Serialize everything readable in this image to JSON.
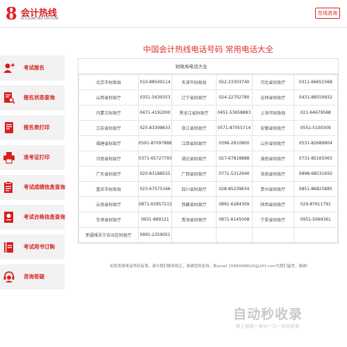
{
  "header": {
    "logo_title": "会计热线",
    "logo_subtitle": "ACCOUNTING HOTLINE",
    "online_button": "在线咨询"
  },
  "sidebar": {
    "items": [
      {
        "label": "考试报名",
        "icon": "user-register-icon"
      },
      {
        "label": "报名状态查询",
        "icon": "status-search-icon"
      },
      {
        "label": "报名表打印",
        "icon": "form-print-icon"
      },
      {
        "label": "准考证打印",
        "icon": "printer-icon"
      },
      {
        "label": "考试成绩信息查询",
        "icon": "score-search-icon"
      },
      {
        "label": "考试合格信息查询",
        "icon": "certificate-search-icon"
      },
      {
        "label": "考试用书订购",
        "icon": "book-icon"
      },
      {
        "label": "咨询答疑",
        "icon": "support-icon"
      }
    ]
  },
  "main": {
    "title": "中国会计热线电话号码 常用电话大全",
    "panel_heading": "财政局电话大全",
    "rows": [
      [
        {
          "name": "北京市财政局",
          "phone": "010-88549114"
        },
        {
          "name": "天津市财政局",
          "phone": "022-23303740"
        },
        {
          "name": "河北省财政厅",
          "phone": "0311-66651568"
        }
      ],
      [
        {
          "name": "山西省财政厅",
          "phone": "0351-5639353"
        },
        {
          "name": "辽宁省财政厅",
          "phone": "024-22702780"
        },
        {
          "name": "吉林省财政厅",
          "phone": "0431-88550932"
        }
      ],
      [
        {
          "name": "内蒙古财政厅",
          "phone": "0471-4192000"
        },
        {
          "name": "黑龙江省财政厅",
          "phone": "0451-53658883"
        },
        {
          "name": "上海市财政局",
          "phone": "021-64679568"
        }
      ],
      [
        {
          "name": "江苏省财政厅",
          "phone": "025-83398633"
        },
        {
          "name": "浙江省财政厅",
          "phone": "0571-87055714"
        },
        {
          "name": "安徽省财政厅",
          "phone": "0551-5100309"
        }
      ],
      [
        {
          "name": "福建省财政厅",
          "phone": "0591-87097888"
        },
        {
          "name": "江西省财政厅",
          "phone": "0396-2610800"
        },
        {
          "name": "山东省财政厅",
          "phone": "0531-82689904"
        }
      ],
      [
        {
          "name": "河南省财政厅",
          "phone": "0371-65727793"
        },
        {
          "name": "湖北省财政厅",
          "phone": "027-67818888"
        },
        {
          "name": "湖南省财政厅",
          "phone": "0731-85165063"
        }
      ],
      [
        {
          "name": "广东省财政厅",
          "phone": "020-83188555"
        },
        {
          "name": "广西省财政厅",
          "phone": "0771-5312940"
        },
        {
          "name": "海南省财政厅",
          "phone": "0898-68531650"
        }
      ],
      [
        {
          "name": "重庆市财政局",
          "phone": "023-67575166"
        },
        {
          "name": "四川省财政厅",
          "phone": "028-85239634"
        },
        {
          "name": "贵州省财政厅",
          "phone": "0851-86825885"
        }
      ],
      [
        {
          "name": "云南省财政厅",
          "phone": "0871-63957215"
        },
        {
          "name": "西藏省财政厅",
          "phone": "0891-6284309"
        },
        {
          "name": "陕西省财政厅",
          "phone": "029-87611791"
        }
      ],
      [
        {
          "name": "甘肃省财政厅",
          "phone": "0931-889121"
        },
        {
          "name": "青海省财政厅",
          "phone": "0971-6145008"
        },
        {
          "name": "宁夏省财政厅",
          "phone": "0951-5069361"
        }
      ],
      [
        {
          "name": "新疆维吾尔自治区财政厅",
          "phone": "0991-2359051"
        }
      ]
    ],
    "footer": "如您发现电话号码有误，请与我们联系修正，谢谢您的支持，发email 15890088026@163.com为我们留言，谢谢!"
  },
  "watermark": {
    "logo": "自动秒收录",
    "slogan": "数上链接一来访一次一自动收录"
  },
  "colors": {
    "accent": "#d81e1e",
    "sidebar_bg": "#f2f2f2",
    "border": "#dddddd"
  }
}
